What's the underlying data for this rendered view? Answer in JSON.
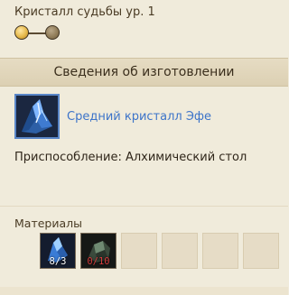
{
  "header": {
    "title": "Кристалл судьбы ур. 1",
    "level": {
      "current": 1,
      "max": 2
    }
  },
  "section": {
    "title": "Сведения об изготовлении"
  },
  "result": {
    "name": "Средний кристалл Эфе",
    "icon": "blue-crystal-icon",
    "rarity_color": "#5a86c8"
  },
  "tool": {
    "text": "Приспособление: Алхимический стол"
  },
  "materials": {
    "label": "Материалы",
    "slots": [
      {
        "icon": "blue-crystal-shard-icon",
        "count": "8/3",
        "sufficient": true
      },
      {
        "icon": "dark-ore-icon",
        "count": "0/10",
        "sufficient": false
      },
      {
        "icon": "",
        "count": ""
      },
      {
        "icon": "",
        "count": ""
      },
      {
        "icon": "",
        "count": ""
      },
      {
        "icon": "",
        "count": ""
      }
    ]
  },
  "colors": {
    "background": "#f0ebdb",
    "link": "#3d74c9",
    "insufficient": "#d43c3c"
  }
}
